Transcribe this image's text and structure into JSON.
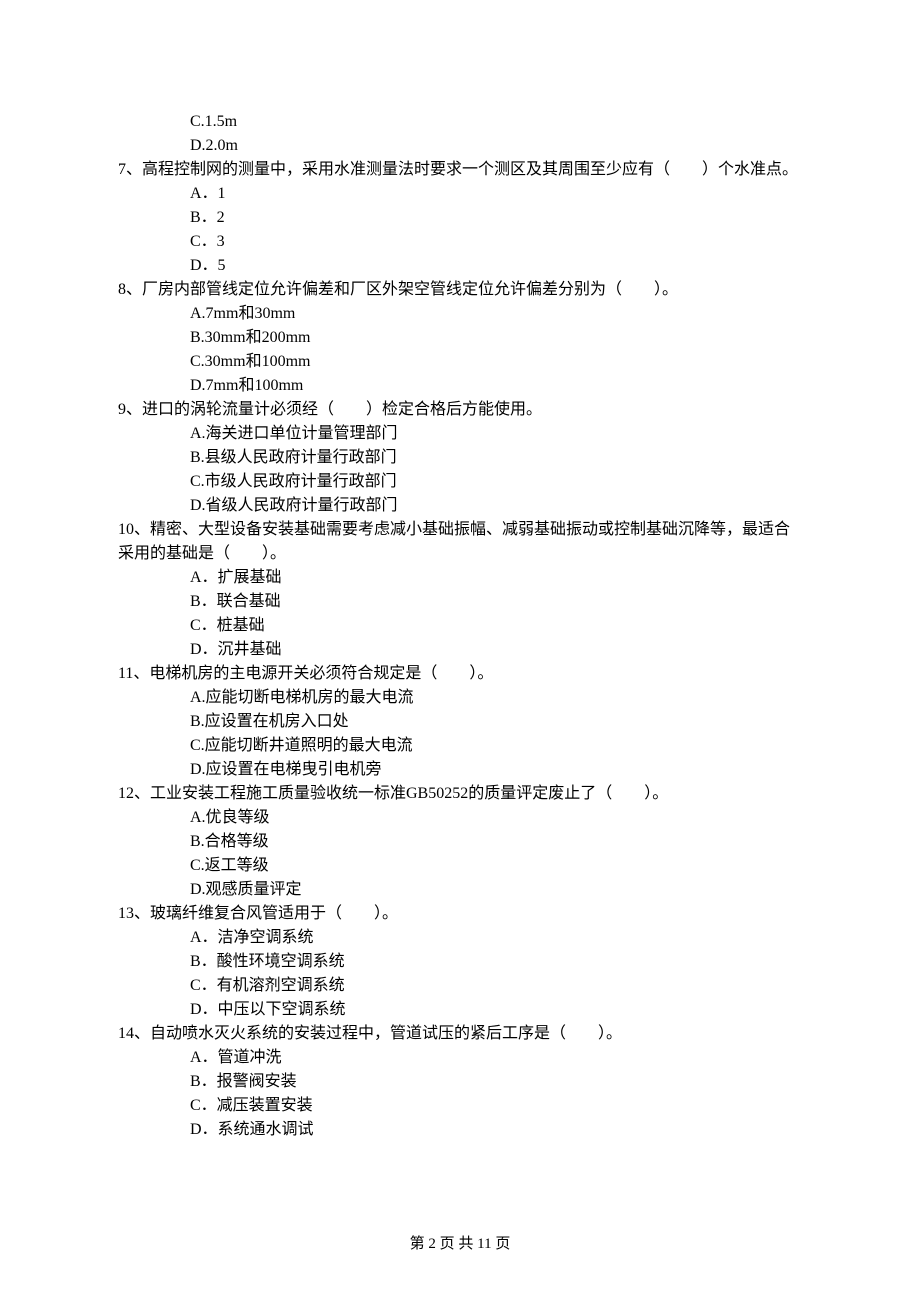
{
  "pre_options": [
    "C.1.5m",
    "D.2.0m"
  ],
  "questions": [
    {
      "stem": "7、高程控制网的测量中，采用水准测量法时要求一个测区及其周围至少应有（　　）个水准点。",
      "options": [
        "A．1",
        "B．2",
        "C．3",
        "D．5"
      ]
    },
    {
      "stem": "8、厂房内部管线定位允许偏差和厂区外架空管线定位允许偏差分别为（　　）。",
      "options": [
        "A.7mm和30mm",
        "B.30mm和200mm",
        "C.30mm和100mm",
        "D.7mm和100mm"
      ]
    },
    {
      "stem": "9、进口的涡轮流量计必须经（　　）检定合格后方能使用。",
      "options": [
        "A.海关进口单位计量管理部门",
        "B.县级人民政府计量行政部门",
        "C.市级人民政府计量行政部门",
        "D.省级人民政府计量行政部门"
      ]
    },
    {
      "stem": "10、精密、大型设备安装基础需要考虑减小基础振幅、减弱基础振动或控制基础沉降等，最适合采用的基础是（　　）。",
      "options": [
        "A．扩展基础",
        "B．联合基础",
        "C．桩基础",
        "D．沉井基础"
      ]
    },
    {
      "stem": "11、电梯机房的主电源开关必须符合规定是（　　）。",
      "options": [
        "A.应能切断电梯机房的最大电流",
        "B.应设置在机房入口处",
        "C.应能切断井道照明的最大电流",
        "D.应设置在电梯曳引电机旁"
      ]
    },
    {
      "stem": "12、工业安装工程施工质量验收统一标准GB50252的质量评定废止了（　　）。",
      "options": [
        "A.优良等级",
        "B.合格等级",
        "C.返工等级",
        "D.观感质量评定"
      ]
    },
    {
      "stem": "13、玻璃纤维复合风管适用于（　　）。",
      "options": [
        "A．洁净空调系统",
        "B．酸性环境空调系统",
        "C．有机溶剂空调系统",
        "D．中压以下空调系统"
      ]
    },
    {
      "stem": "14、自动喷水灭火系统的安装过程中，管道试压的紧后工序是（　　）。",
      "options": [
        "A．管道冲洗",
        "B．报警阀安装",
        "C．减压装置安装",
        "D．系统通水调试"
      ]
    }
  ],
  "footer": "第 2 页 共 11 页"
}
